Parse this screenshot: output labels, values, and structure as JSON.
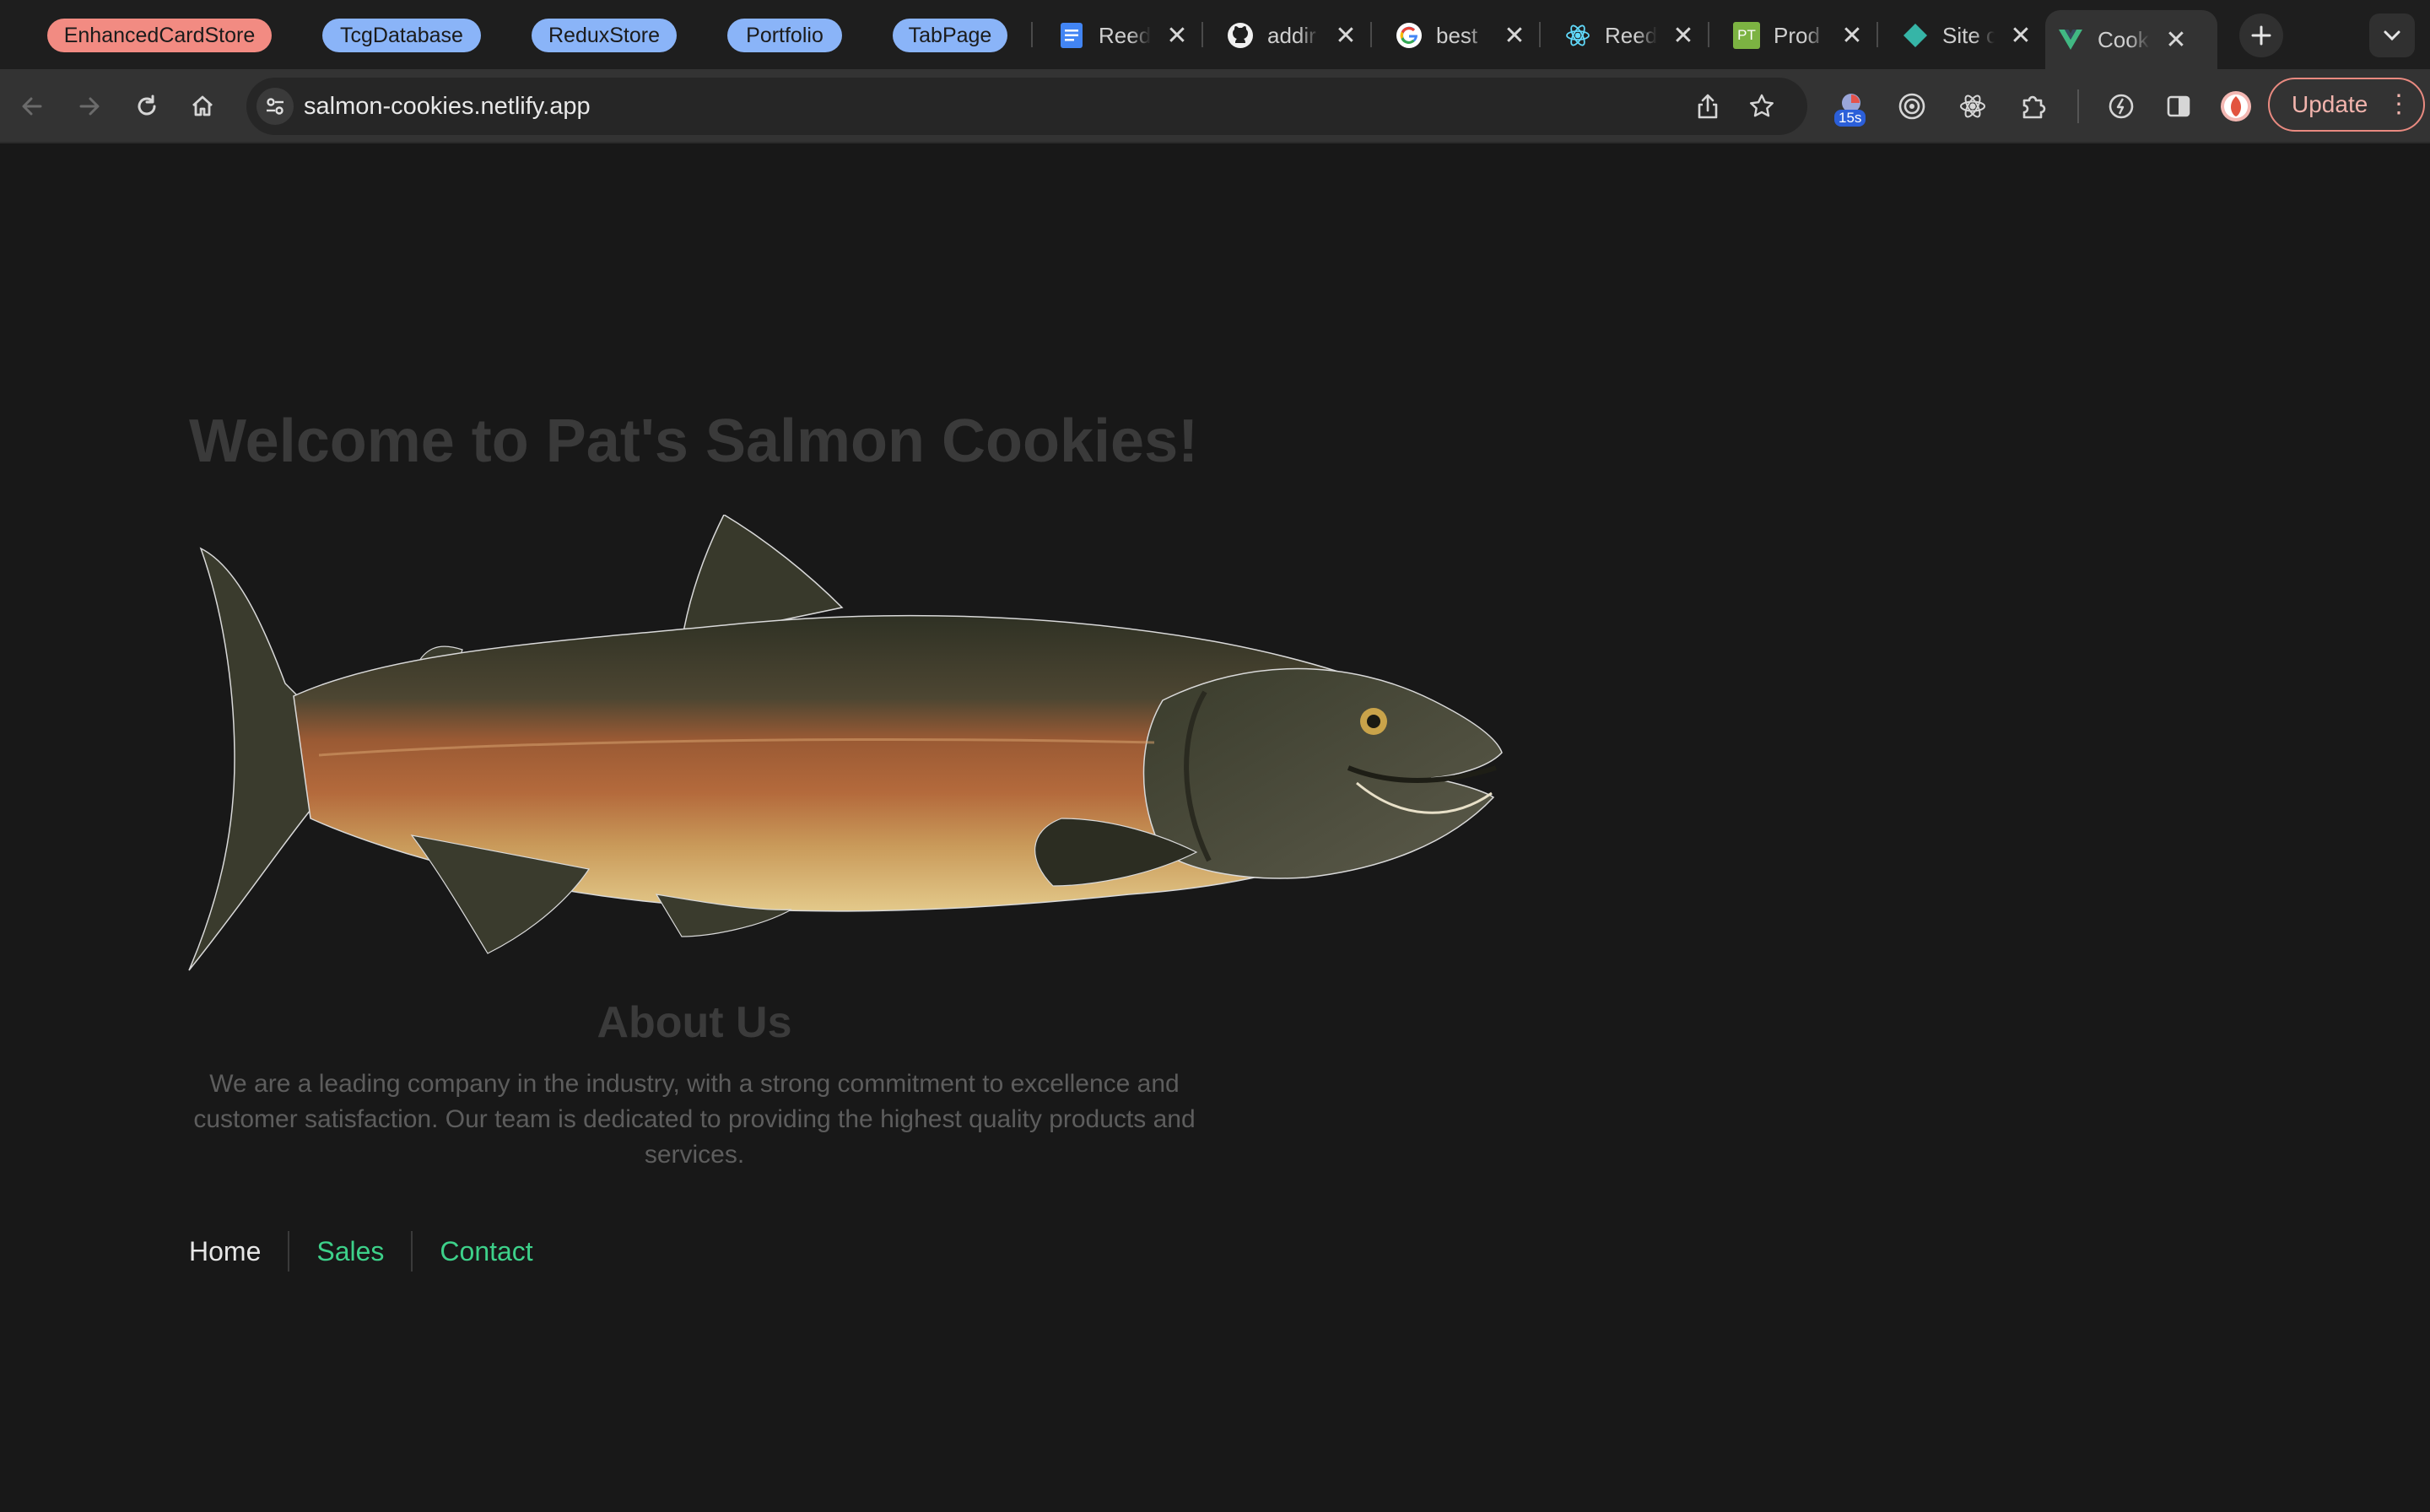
{
  "tab_groups": [
    {
      "label": "EnhancedCardStore",
      "color": "#f28b82"
    },
    {
      "label": "TcgDatabase",
      "color": "#8ab4f8"
    },
    {
      "label": "ReduxStore",
      "color": "#8ab4f8"
    },
    {
      "label": "Portfolio",
      "color": "#8ab4f8"
    },
    {
      "label": "TabPage",
      "color": "#8ab4f8"
    }
  ],
  "tabs": [
    {
      "title": "Reed",
      "icon": "docs-icon"
    },
    {
      "title": "addir",
      "icon": "github-icon"
    },
    {
      "title": "best",
      "icon": "google-icon"
    },
    {
      "title": "Reed",
      "icon": "react-icon"
    },
    {
      "title": "Prod",
      "icon": "pt-icon",
      "badge": "PT"
    },
    {
      "title": "Site c",
      "icon": "diamond-icon"
    },
    {
      "title": "Cook",
      "icon": "vue-icon",
      "active": true
    }
  ],
  "toolbar": {
    "url": "salmon-cookies.netlify.app",
    "timer_badge": "15s",
    "update_label": "Update"
  },
  "page": {
    "heading": "Welcome to Pat's Salmon Cookies!",
    "about_title": "About Us",
    "about_text": "We are a leading company in the industry, with a strong commitment to excellence and customer satisfaction. Our team is dedicated to providing the highest quality products and services.",
    "nav": [
      {
        "label": "Home",
        "color": "#e6e6e6"
      },
      {
        "label": "Sales",
        "color": "#3dd18a"
      },
      {
        "label": "Contact",
        "color": "#3dd18a"
      }
    ]
  },
  "colors": {
    "accent_link": "#3dd18a",
    "update_border": "#e98a80"
  }
}
